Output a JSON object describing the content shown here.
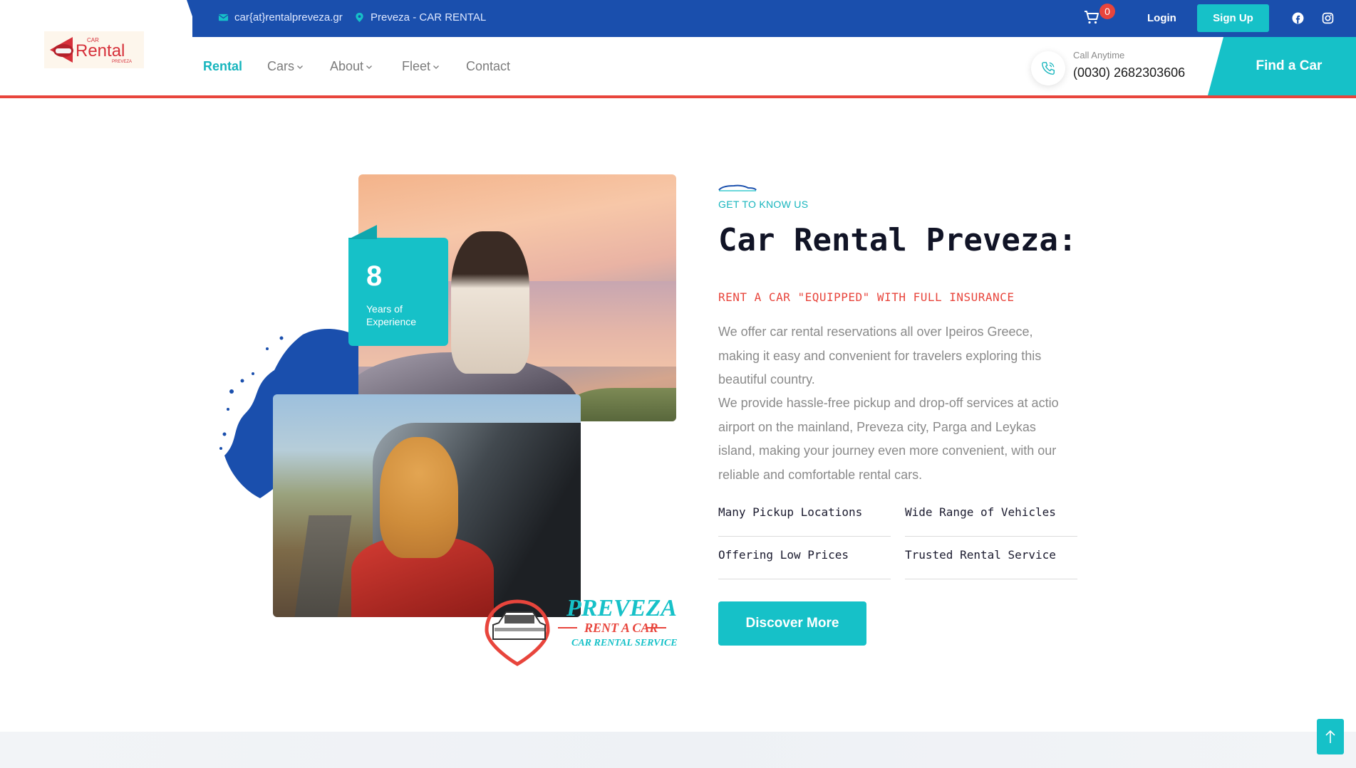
{
  "topbar": {
    "email": "car{at}rentalpreveza.gr",
    "location": "Preveza - CAR RENTAL",
    "cart_count": "0",
    "login_label": "Login",
    "signup_label": "Sign Up"
  },
  "nav": {
    "items": [
      {
        "label": "Rental",
        "active": true
      },
      {
        "label": "Cars",
        "dropdown": true
      },
      {
        "label": "About",
        "dropdown": true
      },
      {
        "label": "Fleet",
        "dropdown": true
      },
      {
        "label": "Contact"
      }
    ],
    "call_label": "Call Anytime",
    "call_number": "(0030) 2682303606",
    "find_car_label": "Find a Car"
  },
  "about": {
    "experience_number": "8",
    "experience_text": "Years of Experience",
    "eyebrow": "GET TO KNOW US",
    "title": "Car Rental Preveza:",
    "subtitle": "RENT A CAR \"EQUIPPED\" WITH FULL INSURANCE",
    "paragraph1": "We offer car rental reservations all over Ipeiros Greece, making it easy and convenient for travelers exploring this beautiful country.",
    "paragraph2": "We provide hassle-free pickup and drop-off services at actio airport on the mainland, Preveza city, Parga and Leykas island, making your journey even more convenient, with our reliable and comfortable rental cars.",
    "features": [
      "Many Pickup Locations",
      "Wide Range of Vehicles",
      "Offering Low Prices",
      "Trusted Rental Service"
    ],
    "button_label": "Discover More"
  },
  "brand_logo": {
    "line1": "PREVEZA",
    "line2": "RENT A CAR",
    "line3": "CAR RENTAL SERVICE"
  },
  "site_logo": {
    "small": "CAR",
    "main": "Rental",
    "sub": "PREVEZA"
  },
  "colors": {
    "primary_blue": "#1a4fad",
    "accent_teal": "#16c1c8",
    "accent_red": "#e8453c"
  },
  "icons": [
    "mail-icon",
    "location-pin-icon",
    "cart-icon",
    "facebook-icon",
    "instagram-icon",
    "phone-icon",
    "chevron-down-icon",
    "car-silhouette-icon",
    "arrow-up-icon"
  ]
}
